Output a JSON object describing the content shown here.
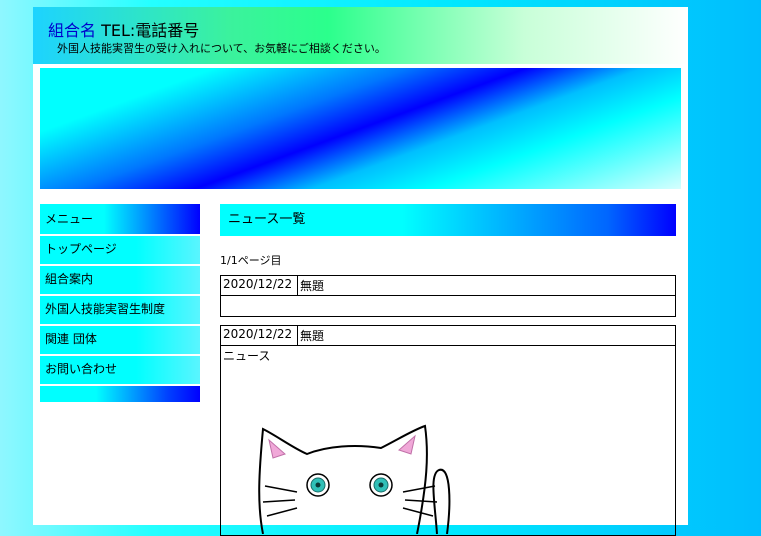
{
  "header": {
    "org_name": "組合名",
    "tel": " TEL:電話番号",
    "tagline": "外国人技能実習生の受け入れについて、お気軽にご相談ください。"
  },
  "sidebar": {
    "menu_title": "メニュー",
    "items": [
      {
        "label": "トップページ"
      },
      {
        "label": "組合案内"
      },
      {
        "label": "外国人技能実習生制度"
      },
      {
        "label": "関連 団体"
      },
      {
        "label": "お問い合わせ"
      }
    ]
  },
  "content": {
    "title": "ニュース一覧",
    "pager": "1/1ページ目",
    "news": [
      {
        "date": "2020/12/22",
        "title": "無題",
        "body": ""
      },
      {
        "date": "2020/12/22",
        "title": "無題",
        "body": "ニュース"
      }
    ]
  },
  "colors": {
    "title_blue": "#0000cc",
    "accent_cyan": "#00ffff",
    "accent_blue": "#0000ff"
  }
}
